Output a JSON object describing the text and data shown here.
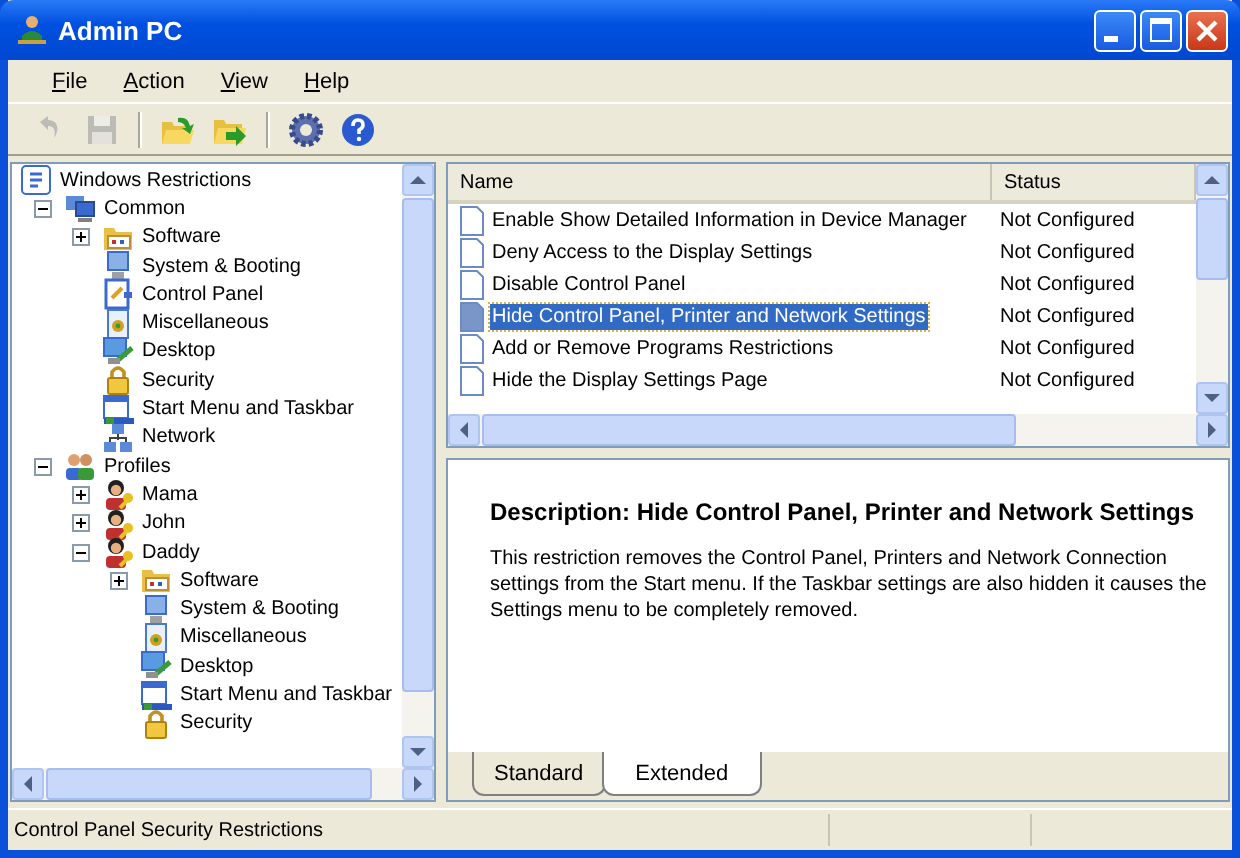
{
  "window": {
    "title": "Admin PC"
  },
  "menu": [
    "File",
    "Action",
    "View",
    "Help"
  ],
  "toolbar": [
    {
      "kind": "undo",
      "disabled": true
    },
    {
      "kind": "save",
      "disabled": true
    },
    {
      "kind": "separator"
    },
    {
      "kind": "open",
      "disabled": false
    },
    {
      "kind": "export",
      "disabled": false
    },
    {
      "kind": "separator"
    },
    {
      "kind": "settings",
      "disabled": false
    },
    {
      "kind": "help",
      "disabled": false
    }
  ],
  "tree": {
    "label": "Windows Restrictions",
    "kind": "root",
    "children": [
      {
        "label": "Common",
        "kind": "computers",
        "expanded": true,
        "children": [
          {
            "label": "Software",
            "kind": "folder",
            "expanded": false
          },
          {
            "label": "System & Booting",
            "kind": "computer"
          },
          {
            "label": "Control Panel",
            "kind": "panel"
          },
          {
            "label": "Miscellaneous",
            "kind": "misc"
          },
          {
            "label": "Desktop",
            "kind": "desktop"
          },
          {
            "label": "Security",
            "kind": "lock"
          },
          {
            "label": "Start Menu and Taskbar",
            "kind": "startmenu"
          },
          {
            "label": "Network",
            "kind": "network"
          }
        ]
      },
      {
        "label": "Profiles",
        "kind": "people",
        "expanded": true,
        "children": [
          {
            "label": "Mama",
            "kind": "user",
            "expanded": false
          },
          {
            "label": "John",
            "kind": "user",
            "expanded": false
          },
          {
            "label": "Daddy",
            "kind": "user",
            "expanded": true,
            "children": [
              {
                "label": "Software",
                "kind": "folder",
                "expanded": false
              },
              {
                "label": "System & Booting",
                "kind": "computer"
              },
              {
                "label": "Miscellaneous",
                "kind": "misc"
              },
              {
                "label": "Desktop",
                "kind": "desktop"
              },
              {
                "label": "Start Menu and Taskbar",
                "kind": "startmenu"
              },
              {
                "label": "Security",
                "kind": "lock"
              }
            ]
          }
        ]
      }
    ]
  },
  "list": {
    "columns": [
      "Name",
      "Status"
    ],
    "rows": [
      {
        "name": "Enable Show Detailed Information in Device Manager",
        "status": "Not Configured",
        "selected": false
      },
      {
        "name": "Deny Access to the Display Settings",
        "status": "Not Configured",
        "selected": false
      },
      {
        "name": "Disable Control Panel",
        "status": "Not Configured",
        "selected": false
      },
      {
        "name": "Hide Control Panel, Printer and Network Settings",
        "status": "Not Configured",
        "selected": true
      },
      {
        "name": "Add or Remove Programs Restrictions",
        "status": "Not Configured",
        "selected": false
      },
      {
        "name": "Hide the Display Settings Page",
        "status": "Not Configured",
        "selected": false
      }
    ]
  },
  "description": {
    "title": "Description: Hide Control Panel, Printer and Network Settings",
    "text": "This restriction removes the Control Panel, Printers and Network Connection settings from the Start menu. If the Taskbar settings are also hidden it causes the Settings menu to be completely removed."
  },
  "tabs": [
    {
      "label": "Standard",
      "selected": false
    },
    {
      "label": "Extended",
      "selected": true
    }
  ],
  "status_bar": "Control Panel Security Restrictions"
}
